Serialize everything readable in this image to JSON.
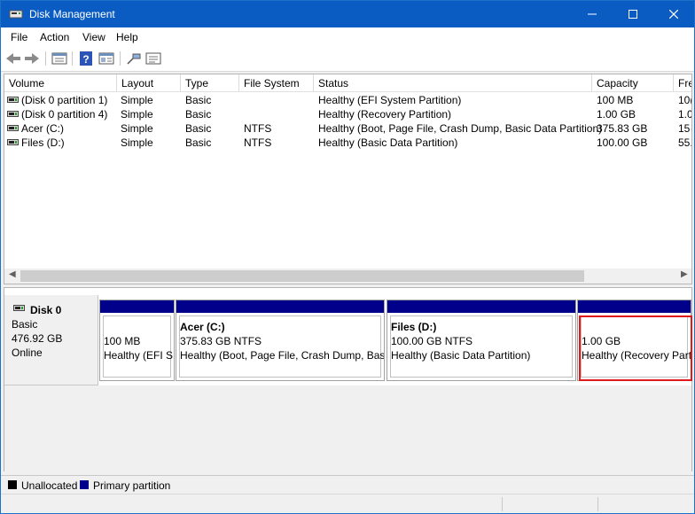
{
  "window": {
    "title": "Disk Management"
  },
  "menu": {
    "items": [
      "File",
      "Action",
      "View",
      "Help"
    ]
  },
  "toolbar": {
    "buttons": [
      "back-arrow-icon",
      "forward-arrow-icon",
      "properties-icon",
      "help-icon",
      "help-topics-icon",
      "connect-icon",
      "list-icon"
    ]
  },
  "volumes": {
    "columns": [
      "Volume",
      "Layout",
      "Type",
      "File System",
      "Status",
      "Capacity",
      "Fre"
    ],
    "rows": [
      {
        "volume": "(Disk 0 partition 1)",
        "layout": "Simple",
        "type": "Basic",
        "fs": "",
        "status": "Healthy (EFI System Partition)",
        "capacity": "100 MB",
        "free": "10("
      },
      {
        "volume": "(Disk 0 partition 4)",
        "layout": "Simple",
        "type": "Basic",
        "fs": "",
        "status": "Healthy (Recovery Partition)",
        "capacity": "1.00 GB",
        "free": "1.0"
      },
      {
        "volume": "Acer (C:)",
        "layout": "Simple",
        "type": "Basic",
        "fs": "NTFS",
        "status": "Healthy (Boot, Page File, Crash Dump, Basic Data Partition)",
        "capacity": "375.83 GB",
        "free": "15·"
      },
      {
        "volume": "Files (D:)",
        "layout": "Simple",
        "type": "Basic",
        "fs": "NTFS",
        "status": "Healthy (Basic Data Partition)",
        "capacity": "100.00 GB",
        "free": "55."
      }
    ]
  },
  "disk": {
    "name": "Disk 0",
    "type": "Basic",
    "size": "476.92 GB",
    "state": "Online",
    "partitions": [
      {
        "name": "",
        "size": "100 MB",
        "status": "Healthy (EFI S"
      },
      {
        "name": "Acer  (C:)",
        "size": "375.83 GB NTFS",
        "status": "Healthy (Boot, Page File, Crash Dump, Basic"
      },
      {
        "name": "Files  (D:)",
        "size": "100.00 GB NTFS",
        "status": "Healthy (Basic Data Partition)"
      },
      {
        "name": "",
        "size": "1.00 GB",
        "status": "Healthy (Recovery Part"
      }
    ]
  },
  "legend": {
    "unallocated": "Unallocated",
    "primary": "Primary partition",
    "unallocated_color": "#000000",
    "primary_color": "#00008b"
  },
  "colors": {
    "titlebar": "#0a5cc2",
    "partition_stripe": "#00008b",
    "highlight": "#e0191b"
  }
}
